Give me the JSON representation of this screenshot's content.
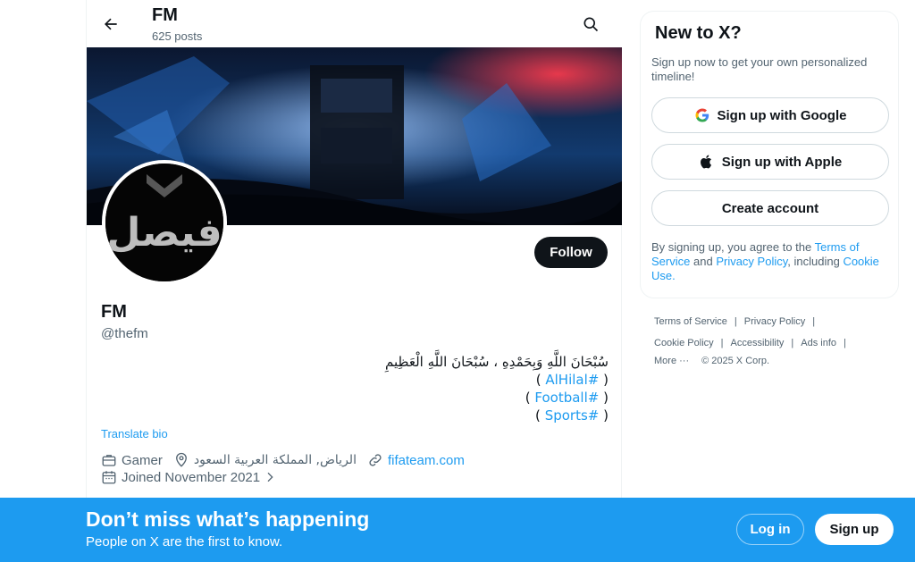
{
  "header": {
    "title": "FM",
    "post_count": "625 posts"
  },
  "profile": {
    "follow_label": "Follow",
    "name": "FM",
    "handle": "@thefm",
    "avatar_text": "فيصل",
    "bio_lines": [
      "سُبْحَانَ اللَّهِ وَبِحَمْدِهِ ، سُبْحَانَ اللَّهِ الْعَظِيمِ",
      "#AlHilal",
      "#Football",
      "#Sports"
    ],
    "bio_paren_open": "(",
    "bio_paren_close": ")",
    "translate_label": "Translate bio",
    "category": "Gamer",
    "location": "الرياض, المملكة العربية السعود",
    "website": "fifateam.com",
    "joined": "Joined November 2021"
  },
  "signup_card": {
    "title": "New to X?",
    "subtitle": "Sign up now to get your own personalized timeline!",
    "google_label": "Sign up with Google",
    "apple_label": "Sign up with Apple",
    "create_label": "Create account",
    "terms_prefix": "By signing up, you agree to the",
    "terms_link": "Terms of Service",
    "terms_and": "and",
    "privacy_link": "Privacy Policy",
    "terms_including": ", including",
    "cookie_link": "Cookie Use."
  },
  "footer": {
    "links": [
      "Terms of Service",
      "Privacy Policy",
      "Cookie Policy",
      "Accessibility",
      "Ads info",
      "More ···"
    ],
    "copyright": "© 2025 X Corp.",
    "separator": "|"
  },
  "bottom_bar": {
    "title": "Don’t miss what’s happening",
    "subtitle": "People on X are the first to know.",
    "login_label": "Log in",
    "signup_label": "Sign up"
  },
  "colors": {
    "accent": "#1d9bf0",
    "text": "#0f1419",
    "muted": "#536471",
    "border": "#eff3f4"
  },
  "icons": [
    "back-arrow-icon",
    "search-icon",
    "google-icon",
    "apple-icon",
    "briefcase-icon",
    "location-pin-icon",
    "link-icon",
    "calendar-icon",
    "chevron-right-icon"
  ]
}
